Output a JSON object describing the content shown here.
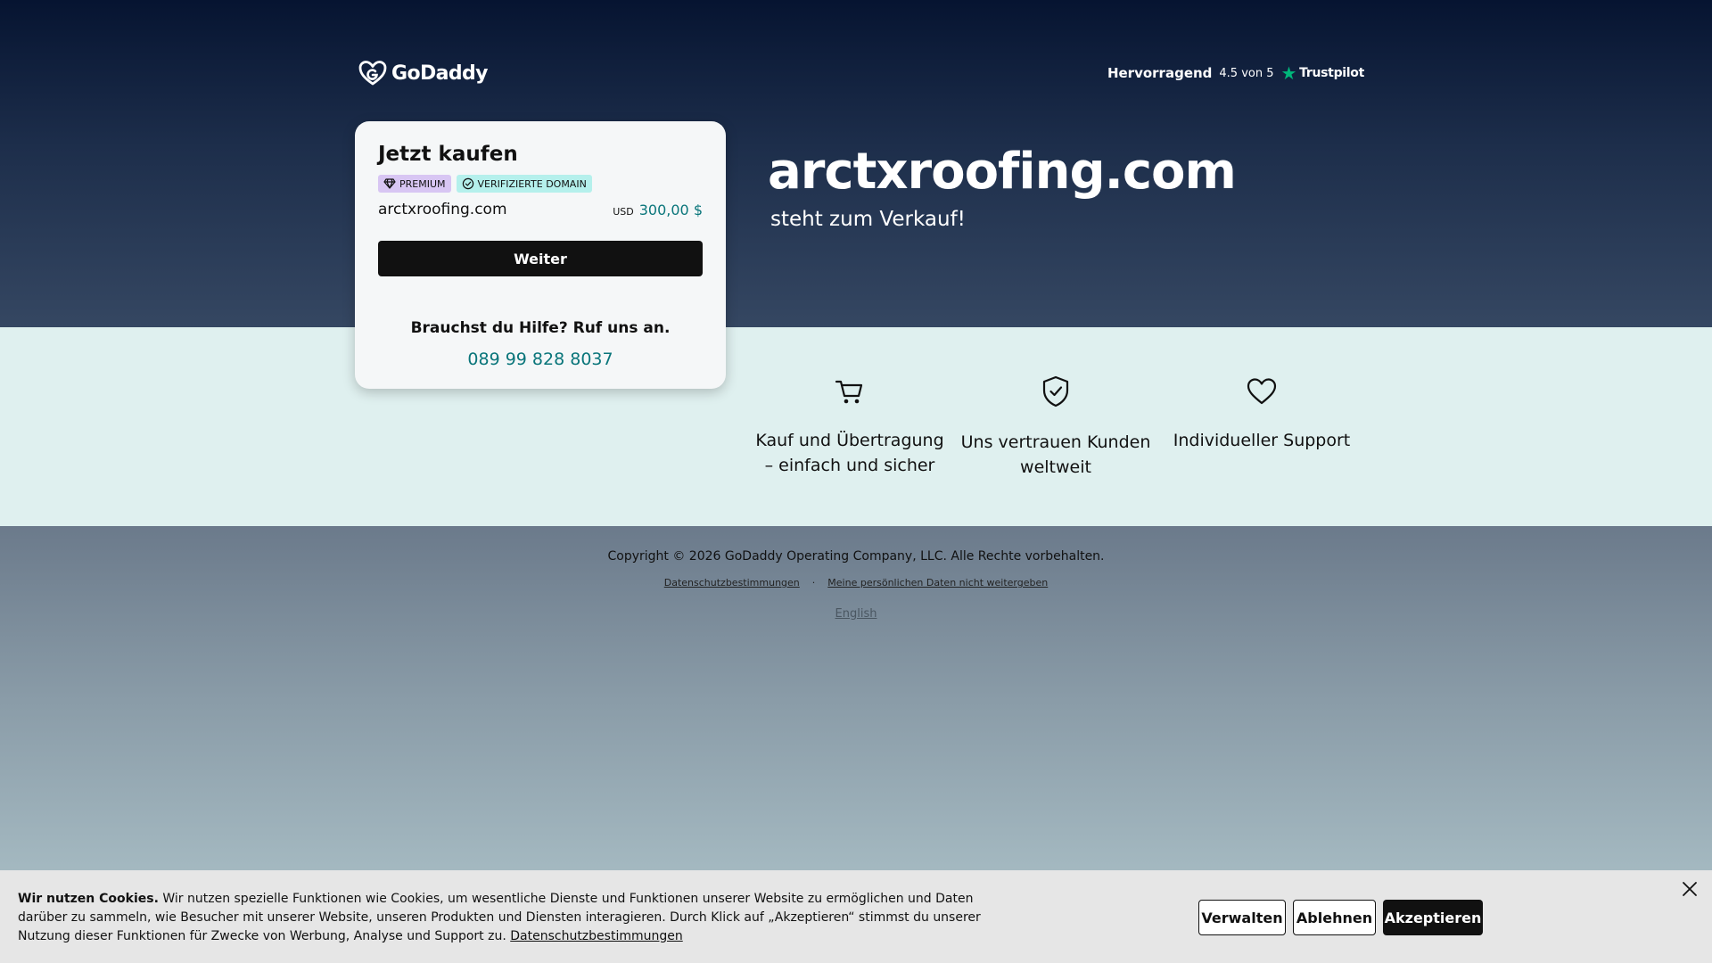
{
  "header": {
    "logo_text": "GoDaddy",
    "trustpilot": {
      "rating_label": "Hervorragend",
      "score": "4.5 von 5",
      "brand": "Trustpilot",
      "star_color": "#00b67a"
    }
  },
  "hero": {
    "domain": "arctxroofing.com",
    "subtitle": "steht zum Verkauf!"
  },
  "card": {
    "title": "Jetzt kaufen",
    "badges": [
      {
        "label": "PREMIUM",
        "icon": "diamond-icon"
      },
      {
        "label": "VERIFIZIERTE DOMAIN",
        "icon": "check-circle-icon"
      }
    ],
    "domain": "arctxroofing.com",
    "currency": "USD",
    "price": "300,00 $",
    "continue_label": "Weiter",
    "help_text": "Brauchst du Hilfe? Ruf uns an.",
    "phone": "089 99 828 8037",
    "accent_color": "#09757a"
  },
  "features": [
    {
      "icon": "cart-icon",
      "text": "Kauf und Übertragung – einfach und sicher"
    },
    {
      "icon": "shield-check-icon",
      "text": "Uns vertrauen Kunden weltweit"
    },
    {
      "icon": "heart-icon",
      "text": "Individueller Support"
    }
  ],
  "footer": {
    "copyright": "Copyright © 2026 GoDaddy Operating Company, LLC. Alle Rechte vorbehalten.",
    "privacy_link": "Datenschutzbestimmungen",
    "separator": "·",
    "do_not_share_link": "Meine persönlichen Daten nicht weitergeben",
    "language_link": "English"
  },
  "cookie_banner": {
    "heading": "Wir nutzen Cookies.",
    "body": "Wir nutzen spezielle Funktionen wie Cookies, um wesentliche Dienste und Funktionen unserer Website zu ermöglichen und Daten darüber zu sammeln, wie Besucher mit unserer Website, unseren Produkten und Diensten interagieren. Durch Klick auf „Akzeptieren“ stimmst du unserer Nutzung dieser Funktionen für Zwecke von Werbung, Analyse und Support zu.",
    "privacy_link": "Datenschutzbestimmungen",
    "manage_label": "Verwalten",
    "decline_label": "Ablehnen",
    "accept_label": "Akzeptieren"
  }
}
